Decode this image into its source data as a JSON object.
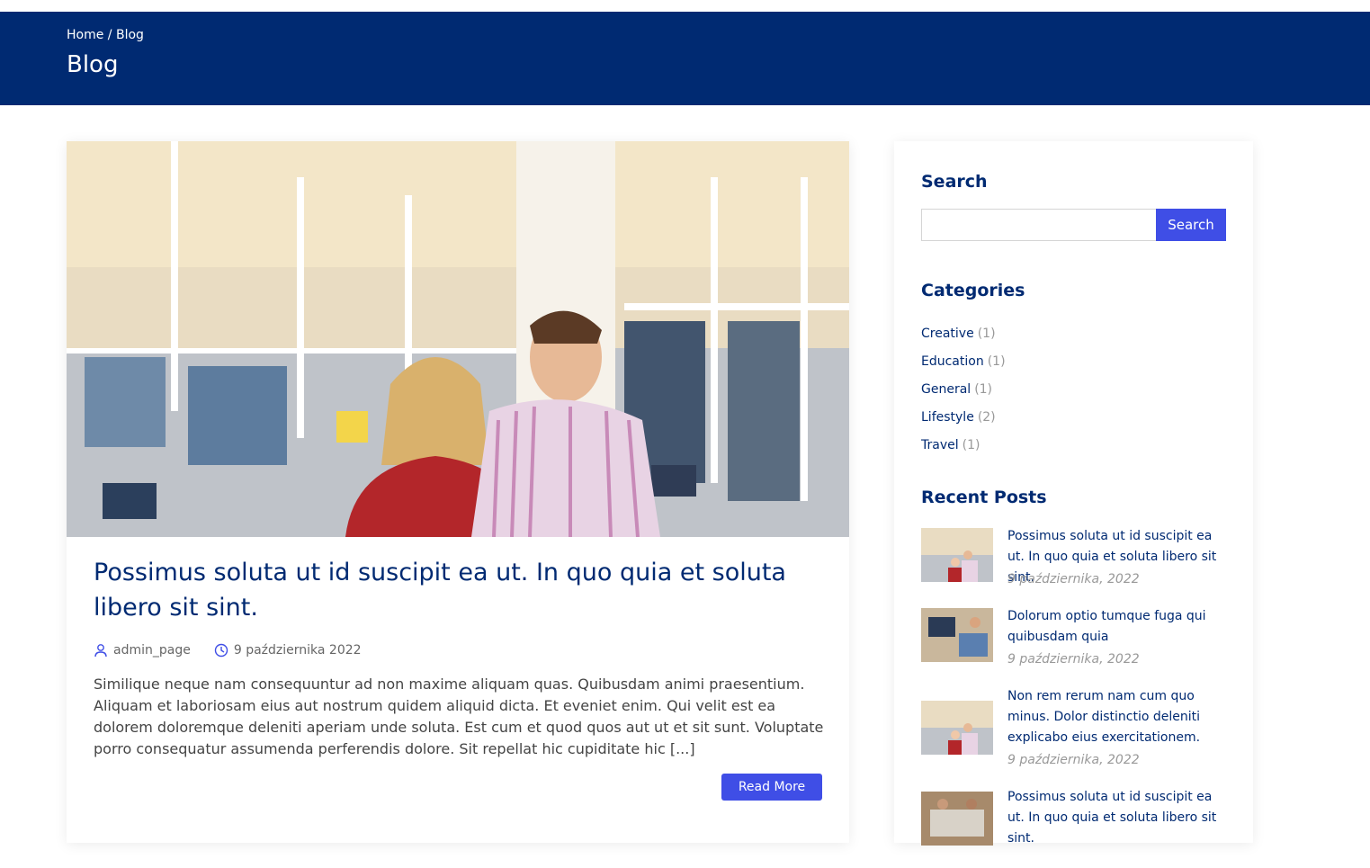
{
  "header": {
    "breadcrumb_home": "Home",
    "breadcrumb_sep": "/",
    "breadcrumb_current": "Blog",
    "title": "Blog",
    "bg_color": "#002a72"
  },
  "post": {
    "title": "Possimus soluta ut id suscipit ea ut. In quo quia et soluta libero sit sint.",
    "author": "admin_page",
    "date": "9 października 2022",
    "excerpt": "Similique neque nam consequuntur ad non maxime aliquam quas. Quibusdam animi praesentium. Aliquam et laboriosam eius aut nostrum quidem aliquid dicta. Et eveniet enim. Qui velit est ea dolorem doloremque deleniti aperiam unde soluta. Est cum et quod quos aut ut et sit sunt. Voluptate porro consequatur assumenda perferendis dolore. Sit repellat hic cupiditate hic [...]",
    "read_more_label": "Read More",
    "image_icon": "office-photo"
  },
  "sidebar": {
    "search_title": "Search",
    "search_button": "Search",
    "search_value": "",
    "categories_title": "Categories",
    "categories": [
      {
        "name": "Creative",
        "count": "(1)"
      },
      {
        "name": "Education",
        "count": "(1)"
      },
      {
        "name": "General",
        "count": "(1)"
      },
      {
        "name": "Lifestyle",
        "count": "(2)"
      },
      {
        "name": "Travel",
        "count": "(1)"
      }
    ],
    "recent_title": "Recent Posts",
    "recent_posts": [
      {
        "title": "Possimus soluta ut id suscipit ea ut. In quo quia et soluta libero sit sint.",
        "date": "9 października, 2022"
      },
      {
        "title": "Dolorum optio tumque fuga qui quibusdam quia",
        "date": "9 października, 2022"
      },
      {
        "title": "Non rem rerum nam cum quo minus. Dolor distinctio deleniti explicabo eius exercitationem.",
        "date": "9 października, 2022"
      },
      {
        "title": "Possimus soluta ut id suscipit ea ut. In quo quia et soluta libero sit sint.",
        "date": ""
      }
    ]
  },
  "colors": {
    "accent": "#3f4ee6",
    "navy": "#002a72"
  }
}
